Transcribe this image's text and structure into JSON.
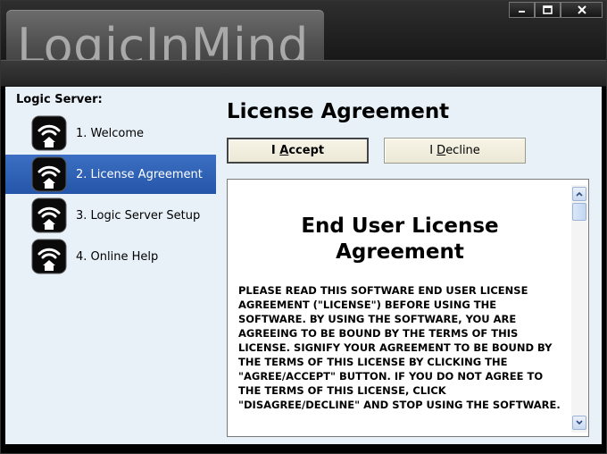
{
  "header": {
    "logo": "LogicInMind"
  },
  "window_controls": {
    "minimize": "minimize-icon",
    "maximize": "maximize-icon",
    "close": "close-icon"
  },
  "sidebar": {
    "title": "Logic Server:",
    "steps": [
      {
        "label": "1. Welcome",
        "icon": "wifi-home-icon",
        "active": false
      },
      {
        "label": "2. License Agreement",
        "icon": "wifi-home-icon",
        "active": true
      },
      {
        "label": "3. Logic Server Setup",
        "icon": "wifi-home-icon",
        "active": false
      },
      {
        "label": "4. Online Help",
        "icon": "wifi-home-icon",
        "active": false
      }
    ]
  },
  "main": {
    "title": "License Agreement",
    "accept": {
      "before": "I ",
      "mnemonic": "A",
      "after": "ccept"
    },
    "decline": {
      "before": "I ",
      "mnemonic": "D",
      "after": "ecline"
    },
    "eula": {
      "title": "End User License Agreement",
      "text": "PLEASE READ THIS SOFTWARE END USER LICENSE AGREEMENT (\"LICENSE\") BEFORE USING THE SOFTWARE. BY USING THE SOFTWARE, YOU ARE AGREEING TO BE BOUND BY THE TERMS OF THIS LICENSE. SIGNIFY YOUR AGREEMENT TO BE BOUND BY THE TERMS OF THIS LICENSE BY CLICKING THE \"AGREE/ACCEPT\" BUTTON. IF YOU DO NOT AGREE TO THE TERMS OF THIS LICENSE, CLICK \"DISAGREE/DECLINE\" AND STOP USING THE SOFTWARE."
    }
  },
  "colors": {
    "active_step": "#2f62b6",
    "panel_bg": "#e8f0f8",
    "header_bg": "#1b1b1b"
  }
}
